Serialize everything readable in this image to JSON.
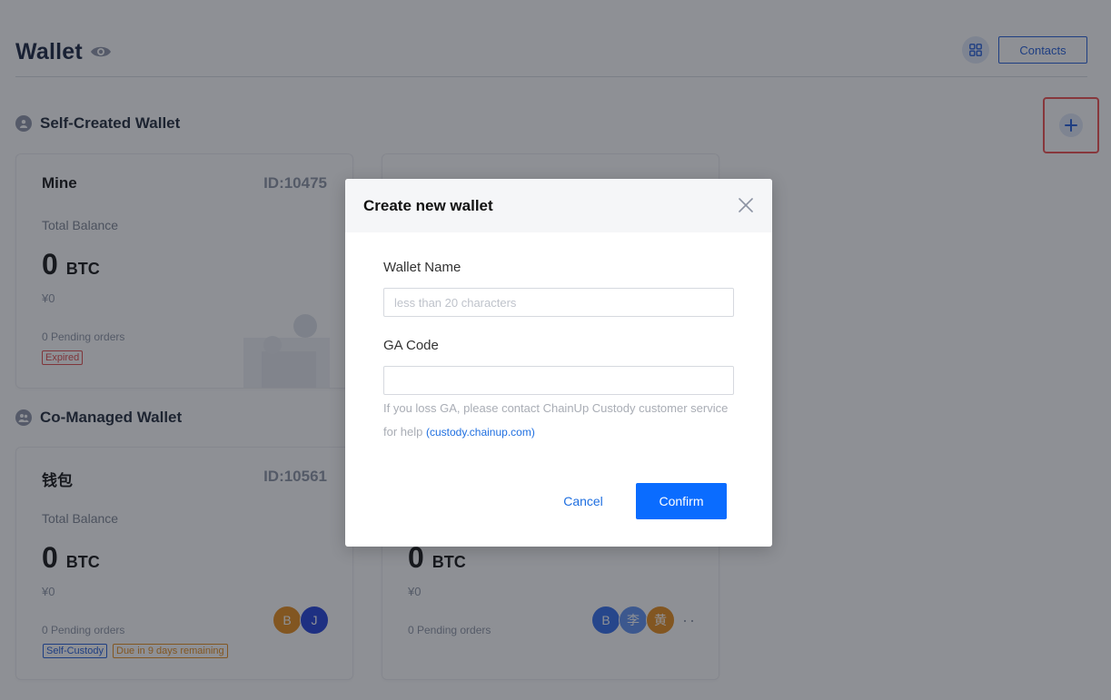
{
  "header": {
    "title": "Wallet",
    "contacts_label": "Contacts"
  },
  "sections": {
    "self_created": "Self-Created Wallet",
    "co_managed": "Co-Managed Wallet"
  },
  "wallets": [
    {
      "name": "Mine",
      "id": "ID:10475",
      "total_label": "Total Balance",
      "balance": "0",
      "unit": "BTC",
      "fiat": "¥0",
      "pending": "0 Pending orders",
      "tags": [
        "Expired"
      ]
    },
    {
      "name": "钱包",
      "id": "ID:10561",
      "total_label": "Total Balance",
      "balance": "0",
      "unit": "BTC",
      "fiat": "¥0",
      "pending": "0 Pending orders",
      "tags": [
        "Self-Custody",
        "Due in 9 days remaining"
      ],
      "members": [
        "B",
        "J"
      ]
    },
    {
      "balance": "0",
      "unit": "BTC",
      "fiat": "¥0",
      "pending": "0 Pending orders",
      "members": [
        "B",
        "李",
        "黄"
      ],
      "more": "··"
    }
  ],
  "modal": {
    "title": "Create new wallet",
    "wallet_name_label": "Wallet Name",
    "wallet_name_placeholder": "less than 20 characters",
    "ga_label": "GA Code",
    "ga_value": "",
    "help_text": "If you loss GA, please contact ChainUp Custody customer service for help",
    "help_link": "(custody.chainup.com)",
    "cancel_label": "Cancel",
    "confirm_label": "Confirm"
  },
  "colors": {
    "accent": "#0a6cff",
    "highlight": "#f04d4d",
    "expired": "#e04848",
    "due": "#e78a17"
  }
}
